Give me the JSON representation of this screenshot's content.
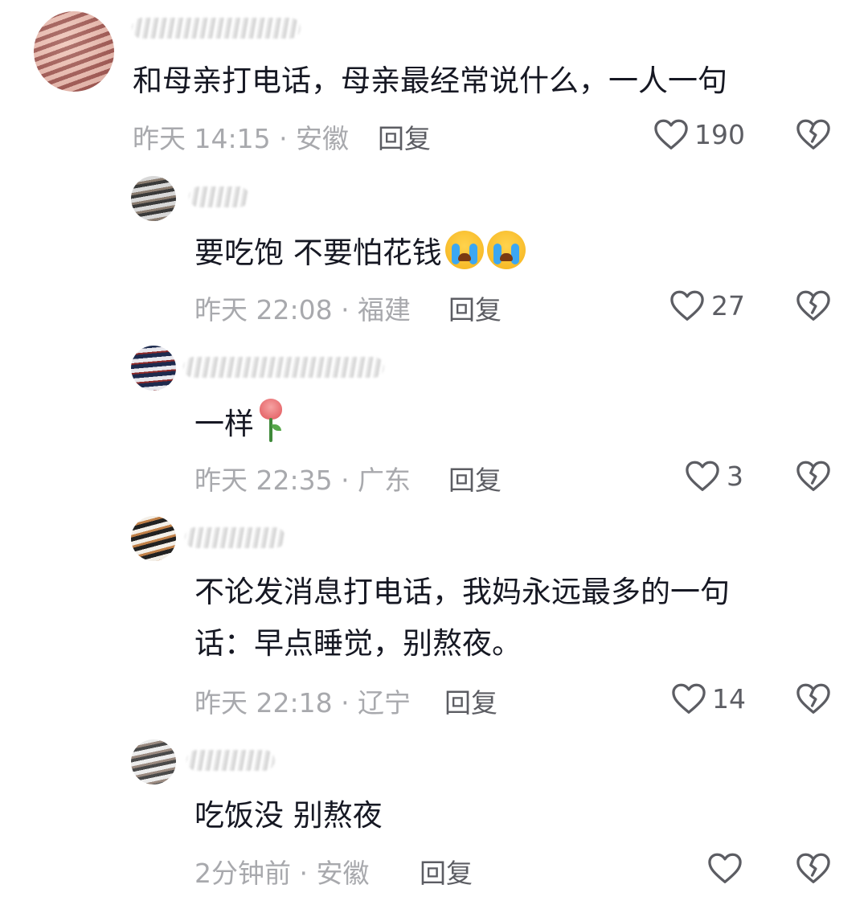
{
  "comments": [
    {
      "text": "和母亲打电话，母亲最经常说什么，一人一句",
      "meta": "昨天 14:15 · 安徽",
      "reply": "回复",
      "likes": "190"
    },
    {
      "text": "要吃饱 不要怕花钱",
      "emoji": "loudly-crying-face x2",
      "meta": "昨天 22:08 · 福建",
      "reply": "回复",
      "likes": "27"
    },
    {
      "text": "一样",
      "emoji": "rose",
      "meta": "昨天 22:35 · 广东",
      "reply": "回复",
      "likes": "3"
    },
    {
      "text_line1": "不论发消息打电话，我妈永远最多的一句",
      "text_line2": "话：早点睡觉，别熬夜。",
      "meta": "昨天 22:18 · 辽宁",
      "reply": "回复",
      "likes": "14"
    },
    {
      "text": "吃饭没 别熬夜",
      "meta": "2分钟前 · 安徽",
      "reply": "回复",
      "likes": ""
    }
  ],
  "icons": {
    "like": "heart-outline-icon",
    "dislike": "broken-heart-icon"
  },
  "colors": {
    "text": "#161823",
    "meta": "#a8a9ad",
    "action": "#5c5d63"
  }
}
